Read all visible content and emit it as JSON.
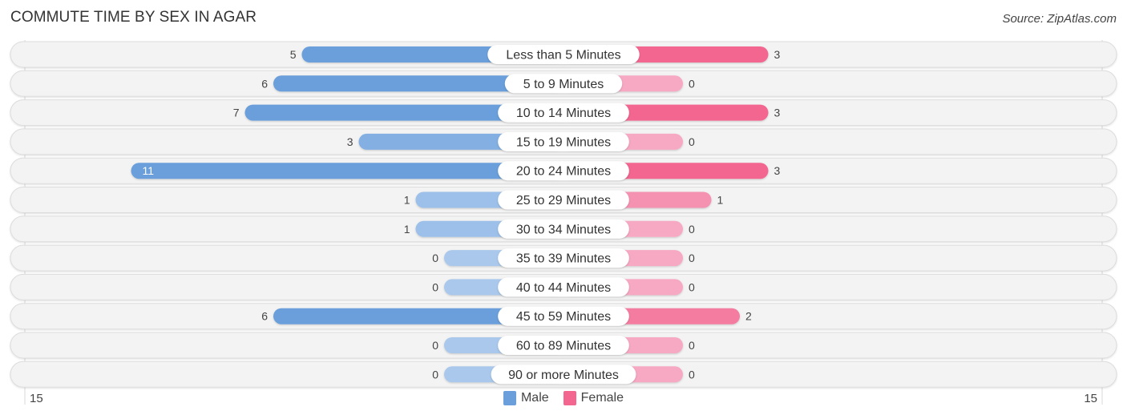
{
  "header": {
    "title": "COMMUTE TIME BY SEX IN AGAR",
    "source": "Source: ZipAtlas.com"
  },
  "colors": {
    "male_strong": "#6a9fdb",
    "male_light": "#a9c8ec",
    "female_strong": "#f26690",
    "female_light": "#f7a8c2",
    "row_bg": "#f3f3f3",
    "row_border": "#dcdcdc"
  },
  "chart_data": {
    "type": "bar",
    "orientation": "horizontal-diverging",
    "title": "COMMUTE TIME BY SEX IN AGAR",
    "categories": [
      "Less than 5 Minutes",
      "5 to 9 Minutes",
      "10 to 14 Minutes",
      "15 to 19 Minutes",
      "20 to 24 Minutes",
      "25 to 29 Minutes",
      "30 to 34 Minutes",
      "35 to 39 Minutes",
      "40 to 44 Minutes",
      "45 to 59 Minutes",
      "60 to 89 Minutes",
      "90 or more Minutes"
    ],
    "series": [
      {
        "name": "Male",
        "values": [
          5,
          6,
          7,
          3,
          11,
          1,
          1,
          0,
          0,
          6,
          0,
          0
        ]
      },
      {
        "name": "Female",
        "values": [
          3,
          0,
          3,
          0,
          3,
          1,
          0,
          0,
          0,
          2,
          0,
          0
        ]
      }
    ],
    "axis": {
      "left_label": "15",
      "right_label": "15",
      "range": [
        -15,
        15
      ]
    },
    "legend": {
      "position": "bottom-center",
      "entries": [
        "Male",
        "Female"
      ]
    },
    "grid": false
  }
}
